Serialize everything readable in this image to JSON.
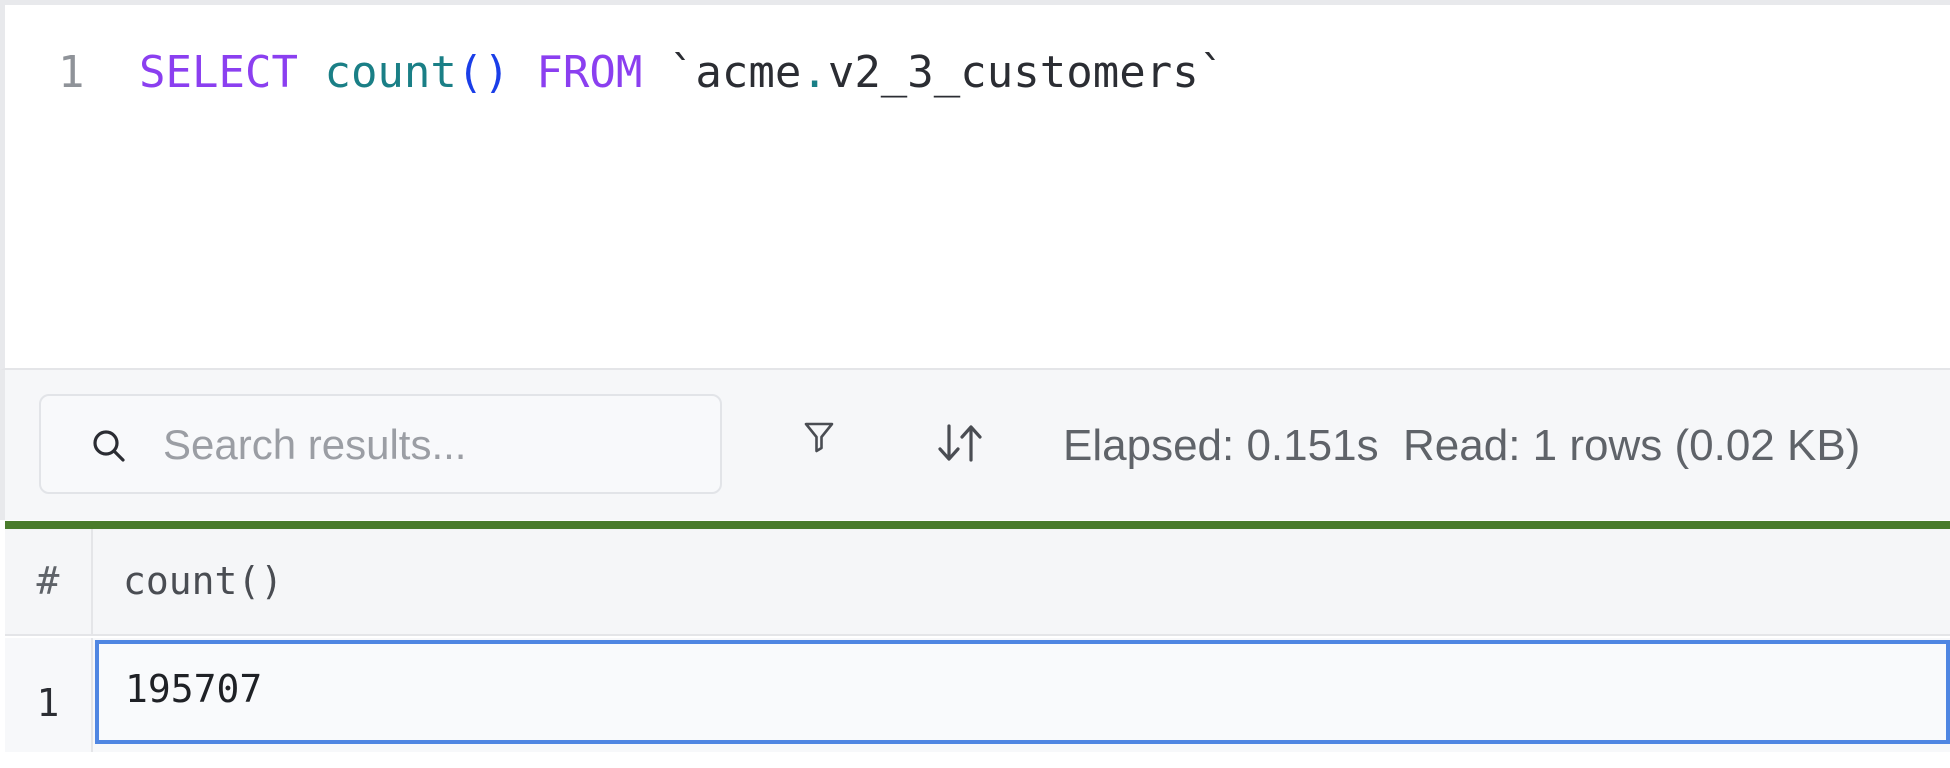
{
  "editor": {
    "line_number": "1",
    "query": {
      "kw_select": "SELECT",
      "fn_count": "count",
      "paren": "()",
      "kw_from": "FROM",
      "tick_open": "`",
      "schema": "acme",
      "dot": ".",
      "table": "v2_3_customers",
      "tick_close": "`"
    }
  },
  "toolbar": {
    "search": {
      "placeholder": "Search results...",
      "value": ""
    },
    "filter_icon": "filter-icon",
    "sort_icon": "sort-icon",
    "elapsed": "Elapsed: 0.151s",
    "read": "Read: 1 rows (0.02 KB)"
  },
  "progress": {
    "value": 1.0,
    "color": "#4a7c2c"
  },
  "results": {
    "columns": [
      "#",
      "count()"
    ],
    "rows": [
      {
        "index": "1",
        "count": "195707"
      }
    ]
  },
  "colors": {
    "keyword": "#8b3ff0",
    "function": "#1a7f86",
    "selection": "#4f86e2"
  }
}
